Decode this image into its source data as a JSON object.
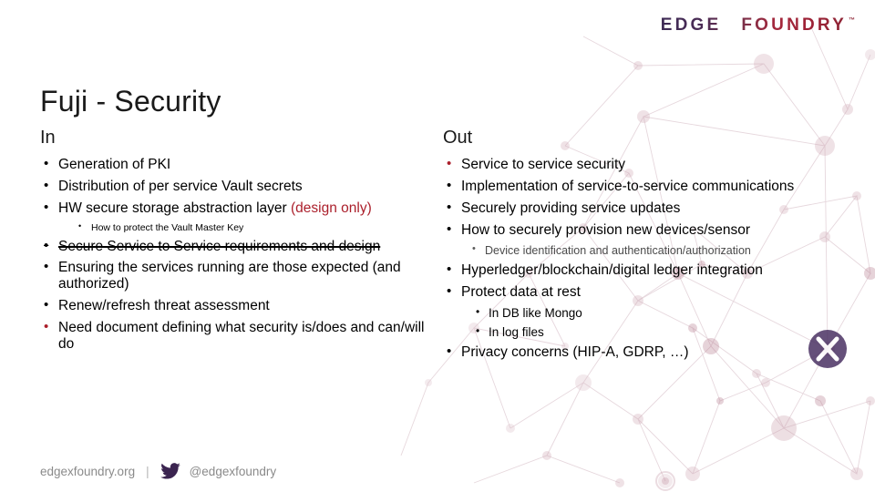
{
  "brand": {
    "logo_part1": "EDGE",
    "logo_x": "X",
    "logo_part2": "FOUNDRY",
    "trademark": "™",
    "accent_red": "#ab1f2b",
    "accent_purple": "#3d2a55",
    "watermark_letter": "X"
  },
  "title": "Fuji - Security",
  "columns": {
    "in": {
      "heading": "In",
      "items": [
        {
          "level": 1,
          "text": "Generation of PKI",
          "color": "black"
        },
        {
          "level": 1,
          "text": "Distribution of per service Vault secrets",
          "color": "black"
        },
        {
          "level": 1,
          "text": "HW secure storage abstraction layer ",
          "suffix_red": "(design only)",
          "color": "black"
        },
        {
          "level": 2,
          "text": "How to protect the Vault Master Key",
          "color": "black"
        },
        {
          "level": 1,
          "text": "Secure Service to Service requirements and design",
          "color": "black",
          "strikethrough": true
        },
        {
          "level": 1,
          "text": "Ensuring the services running are those expected (and authorized)",
          "color": "black"
        },
        {
          "level": 1,
          "text": "Renew/refresh threat assessment",
          "color": "black"
        },
        {
          "level": 1,
          "text": "Need document defining what security is/does and can/will do",
          "color": "red"
        }
      ]
    },
    "out": {
      "heading": "Out",
      "items": [
        {
          "level": 1,
          "text": "Service to service security",
          "color": "red"
        },
        {
          "level": 1,
          "text": "Implementation of service-to-service communications",
          "color": "black"
        },
        {
          "level": 1,
          "text": "Securely providing service updates",
          "color": "black"
        },
        {
          "level": 1,
          "text": "How to securely provision new devices/sensor",
          "color": "black"
        },
        {
          "level": 2,
          "text": "Device identification and authentication/authorization",
          "color": "grey"
        },
        {
          "level": 1,
          "text": "Hyperledger/blockchain/digital ledger integration",
          "color": "black"
        },
        {
          "level": 1,
          "text": "Protect data at rest",
          "color": "black"
        },
        {
          "level": 2,
          "text": "In DB like Mongo",
          "color": "black"
        },
        {
          "level": 2,
          "text": "In log files",
          "color": "black"
        },
        {
          "level": 1,
          "text": "Privacy concerns (HIP-A, GDRP, …)",
          "color": "black"
        }
      ]
    }
  },
  "footer": {
    "website": "edgexfoundry.org",
    "separator": "|",
    "twitter_handle": "@edgexfoundry",
    "twitter_icon": "twitter-bird-icon"
  }
}
